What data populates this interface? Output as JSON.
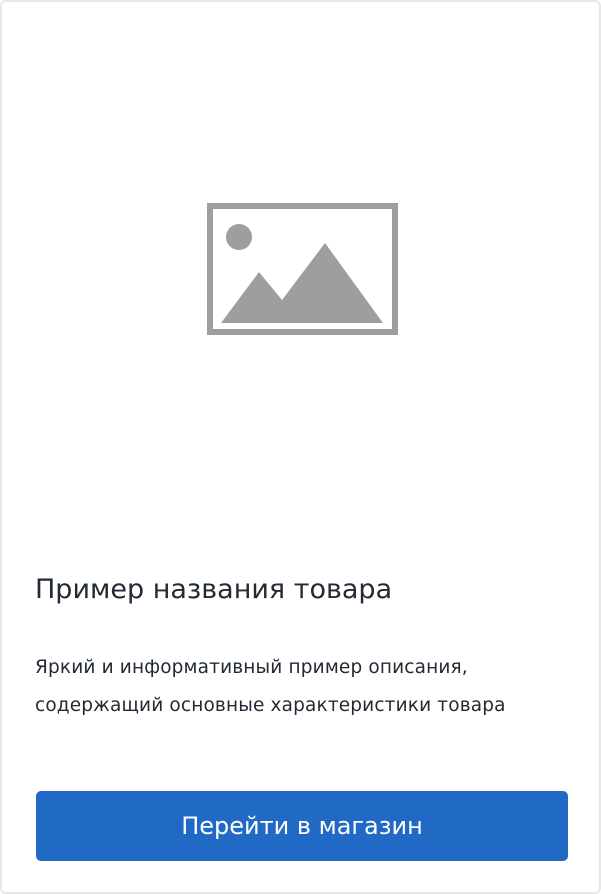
{
  "product": {
    "image_icon": "image-placeholder-icon",
    "title": "Пример названия товара",
    "description": "Яркий и информативный пример описания, содержащий основные характеристики товара",
    "button_label": "Перейти в магазин"
  },
  "colors": {
    "button_bg": "#2069c4",
    "text": "#222a33",
    "placeholder_gray": "#9e9e9e",
    "border": "#e6e8eb"
  }
}
